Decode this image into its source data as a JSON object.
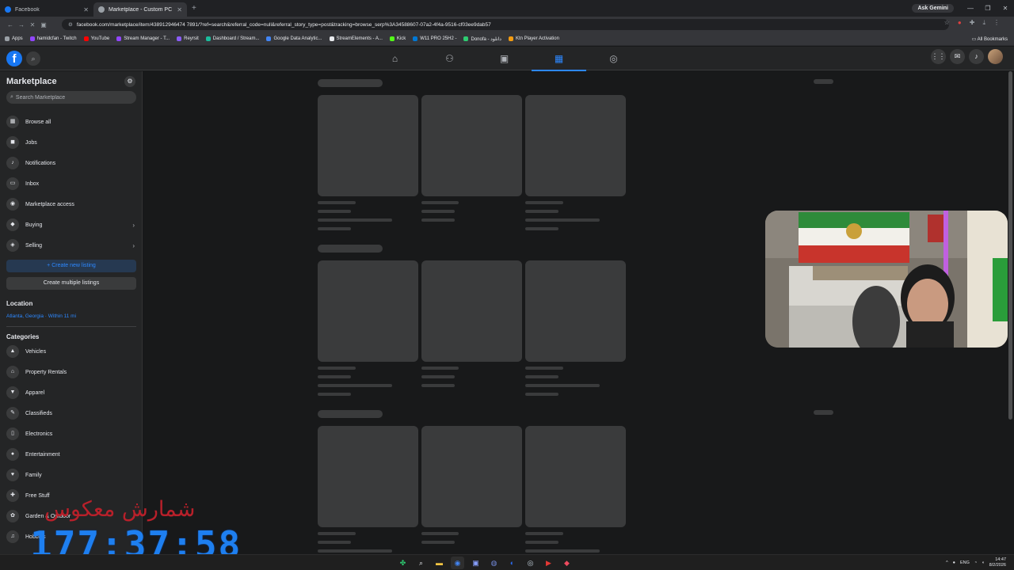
{
  "browser": {
    "tabs": [
      {
        "title": "Facebook",
        "active": false
      },
      {
        "title": "Marketplace - Custom PC [UM...",
        "active": true
      }
    ],
    "ask_gemini": "Ask Gemini",
    "url": "facebook.com/marketplace/item/438912946474 7891/?ref=search&referral_code=null&referral_story_type=post&tracking=browse_serp%3A34588607-07a2-4f4a-9516-cf03ee9dab57",
    "bookmarks": [
      "Apps",
      "hamidcfan - Twitch",
      "YouTube",
      "Stream Manager - T...",
      "Reyrsit",
      "Dashboard / Stream...",
      "Google Data Analytic...",
      "StreamElements - A...",
      "Kick",
      "W11 PRO 25H2 -",
      "Donofa - دانلود",
      "Ktn Player Activation"
    ],
    "all_bookmarks": "All Bookmarks"
  },
  "sidebar": {
    "title": "Marketplace",
    "search_placeholder": "Search Marketplace",
    "items": [
      {
        "label": "Browse all",
        "icon": "store-icon",
        "glyph": "▦"
      },
      {
        "label": "Jobs",
        "icon": "briefcase-icon",
        "glyph": "◼"
      },
      {
        "label": "Notifications",
        "icon": "bell-icon",
        "glyph": "♪"
      },
      {
        "label": "Inbox",
        "icon": "inbox-icon",
        "glyph": "▭"
      },
      {
        "label": "Marketplace access",
        "icon": "access-icon",
        "glyph": "◉"
      },
      {
        "label": "Buying",
        "icon": "bag-icon",
        "glyph": "◆"
      },
      {
        "label": "Selling",
        "icon": "tag-icon",
        "glyph": "◈"
      }
    ],
    "create_listing": "+ Create new listing",
    "create_multiple": "Create multiple listings",
    "location_heading": "Location",
    "location_value": "Atlanta, Georgia · Within 11 mi",
    "categories_heading": "Categories",
    "categories": [
      {
        "label": "Vehicles",
        "icon": "car-icon",
        "glyph": "▲"
      },
      {
        "label": "Property Rentals",
        "icon": "house-icon",
        "glyph": "⌂"
      },
      {
        "label": "Apparel",
        "icon": "shirt-icon",
        "glyph": "▼"
      },
      {
        "label": "Classifieds",
        "icon": "classifieds-icon",
        "glyph": "✎"
      },
      {
        "label": "Electronics",
        "icon": "phone-icon",
        "glyph": "▯"
      },
      {
        "label": "Entertainment",
        "icon": "film-icon",
        "glyph": "●"
      },
      {
        "label": "Family",
        "icon": "heart-icon",
        "glyph": "♥"
      },
      {
        "label": "Free Stuff",
        "icon": "gift-icon",
        "glyph": "✚"
      },
      {
        "label": "Garden & Outdoor",
        "icon": "plant-icon",
        "glyph": "✿"
      },
      {
        "label": "Hobbies",
        "icon": "guitar-icon",
        "glyph": "♫"
      }
    ]
  },
  "overlay": {
    "persian_text": "شمارش معکوس",
    "timer": "177:37:58"
  },
  "taskbar": {
    "lang": "ENG",
    "time": "14:47",
    "date": "8/2/2026"
  }
}
